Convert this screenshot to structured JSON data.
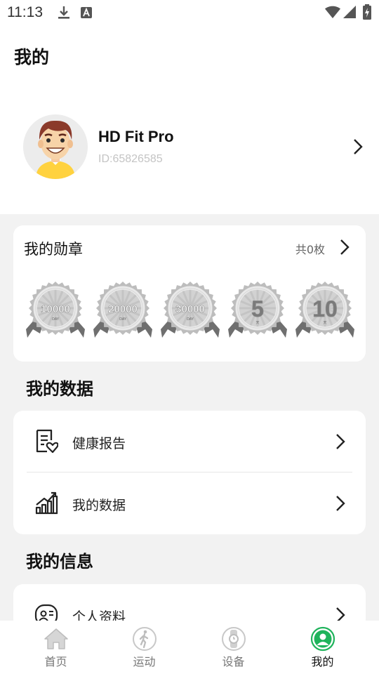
{
  "status_bar": {
    "time": "11:13"
  },
  "page": {
    "title": "我的"
  },
  "profile": {
    "name": "HD Fit Pro",
    "id": "ID:65826585"
  },
  "medals": {
    "title": "我的勋章",
    "count": "共0枚",
    "badges": [
      {
        "value": "10000",
        "unit": "DAY"
      },
      {
        "value": "20000",
        "unit": "DAY"
      },
      {
        "value": "30000",
        "unit": "DAY"
      },
      {
        "value": "5",
        "unit": "天"
      },
      {
        "value": "10",
        "unit": "天"
      }
    ]
  },
  "my_data": {
    "title": "我的数据",
    "items": [
      {
        "label": "健康报告",
        "icon": "health-report-icon"
      },
      {
        "label": "我的数据",
        "icon": "bar-chart-icon"
      }
    ]
  },
  "my_info": {
    "title": "我的信息",
    "items": [
      {
        "label": "个人资料",
        "icon": "profile-card-icon"
      }
    ]
  },
  "tabbar": {
    "items": [
      {
        "label": "首页",
        "icon": "home-icon",
        "active": false
      },
      {
        "label": "运动",
        "icon": "run-icon",
        "active": false
      },
      {
        "label": "设备",
        "icon": "watch-icon",
        "active": false
      },
      {
        "label": "我的",
        "icon": "user-icon",
        "active": true
      }
    ],
    "active_color": "#1fb35b"
  }
}
